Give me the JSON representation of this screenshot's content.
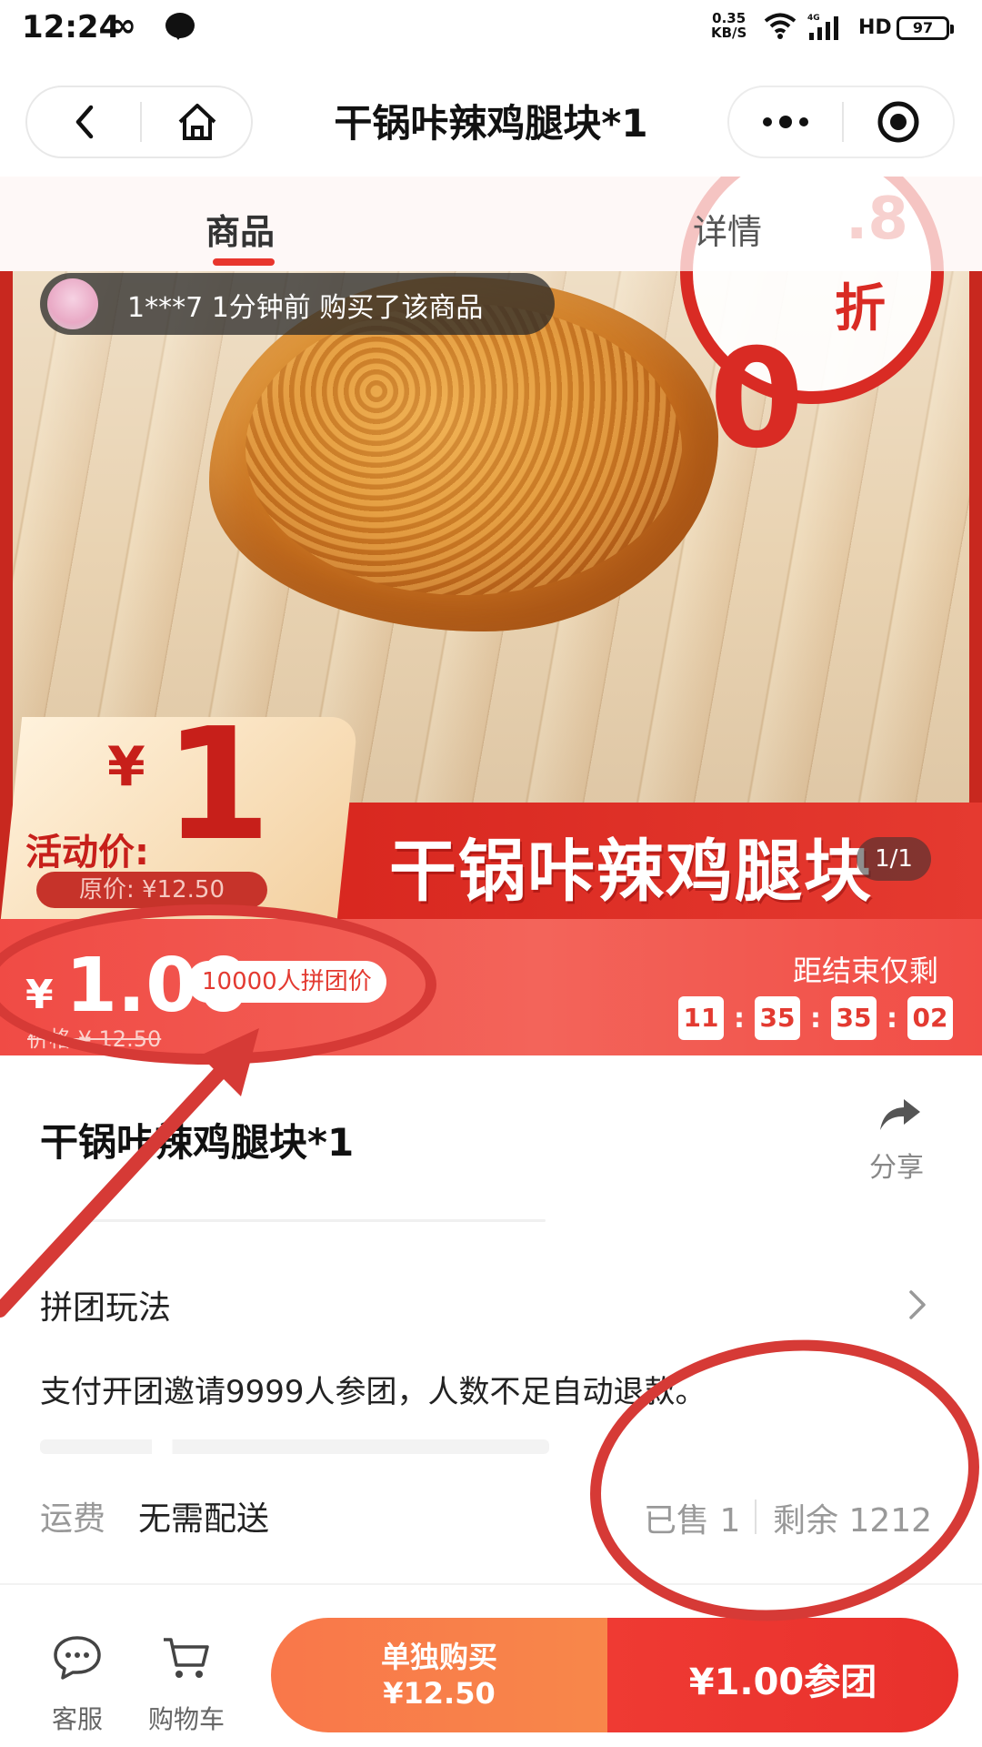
{
  "status_bar": {
    "time": "12:24",
    "infinity": "∞",
    "speed_value": "0.35",
    "speed_unit": "KB/S",
    "network": "4G",
    "hd": "HD",
    "battery": "97"
  },
  "nav": {
    "title": "干锅咔辣鸡腿块*1",
    "back_icon": "chevron-left-icon",
    "home_icon": "home-icon",
    "more_icon": "more-dots-icon",
    "close_icon": "target-icon"
  },
  "tabs": [
    {
      "label": "商品",
      "active": true
    },
    {
      "label": "详情",
      "active": false
    }
  ],
  "hero": {
    "buyer_toast": "1***7 1分钟前 购买了该商品",
    "discount_number": "0",
    "discount_decimal": ".8",
    "discount_unit": "折",
    "ribbon_title": "干锅咔辣鸡腿块",
    "image_counter": "1/1",
    "activity_yen": "¥",
    "activity_price": "1",
    "activity_label": "活动价:",
    "activity_original": "原价: ¥12.50"
  },
  "price_bar": {
    "currency": "¥",
    "price_main": "1.00",
    "badge": "10000人拼团价",
    "original": "价格 ¥ 12.50",
    "countdown_label": "距结束仅剩",
    "countdown": [
      "11",
      "35",
      "35",
      "02"
    ]
  },
  "product": {
    "name": "干锅咔辣鸡腿块*1",
    "share_label": "分享"
  },
  "rules": {
    "label": "拼团玩法",
    "description": "支付开团邀请9999人参团，人数不足自动退款。"
  },
  "shipping": {
    "label": "运费",
    "value": "无需配送",
    "sold": "已售 1",
    "remaining": "剩余 1212"
  },
  "bottom_bar": {
    "service_label": "客服",
    "cart_label": "购物车",
    "solo_line1": "单独购买",
    "solo_line2": "¥12.50",
    "group_label": "¥1.00参团"
  },
  "colors": {
    "accent_red": "#e8362d",
    "orange_button": "#f9774a",
    "annotation_red": "#d63a36"
  }
}
